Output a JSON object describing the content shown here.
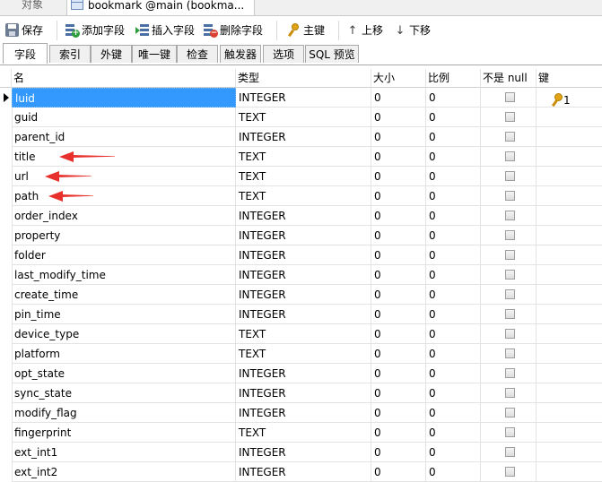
{
  "tabs": {
    "objects": "对象",
    "active": "bookmark @main (bookma..."
  },
  "toolbar": {
    "save": "保存",
    "add_field": "添加字段",
    "insert_field": "插入字段",
    "delete_field": "删除字段",
    "primary_key": "主键",
    "move_up": "上移",
    "move_down": "下移"
  },
  "section_tabs": [
    "字段",
    "索引",
    "外键",
    "唯一键",
    "检查",
    "触发器",
    "选项",
    "SQL 预览"
  ],
  "columns": {
    "name": "名",
    "type": "类型",
    "size": "大小",
    "scale": "比例",
    "not_null": "不是 null",
    "key": "键"
  },
  "rows": [
    {
      "name": "luid",
      "type": "INTEGER",
      "size": "0",
      "scale": "0",
      "key": "1"
    },
    {
      "name": "guid",
      "type": "TEXT",
      "size": "0",
      "scale": "0",
      "key": ""
    },
    {
      "name": "parent_id",
      "type": "INTEGER",
      "size": "0",
      "scale": "0",
      "key": ""
    },
    {
      "name": "title",
      "type": "TEXT",
      "size": "0",
      "scale": "0",
      "key": ""
    },
    {
      "name": "url",
      "type": "TEXT",
      "size": "0",
      "scale": "0",
      "key": ""
    },
    {
      "name": "path",
      "type": "TEXT",
      "size": "0",
      "scale": "0",
      "key": ""
    },
    {
      "name": "order_index",
      "type": "INTEGER",
      "size": "0",
      "scale": "0",
      "key": ""
    },
    {
      "name": "property",
      "type": "INTEGER",
      "size": "0",
      "scale": "0",
      "key": ""
    },
    {
      "name": "folder",
      "type": "INTEGER",
      "size": "0",
      "scale": "0",
      "key": ""
    },
    {
      "name": "last_modify_time",
      "type": "INTEGER",
      "size": "0",
      "scale": "0",
      "key": ""
    },
    {
      "name": "create_time",
      "type": "INTEGER",
      "size": "0",
      "scale": "0",
      "key": ""
    },
    {
      "name": "pin_time",
      "type": "INTEGER",
      "size": "0",
      "scale": "0",
      "key": ""
    },
    {
      "name": "device_type",
      "type": "TEXT",
      "size": "0",
      "scale": "0",
      "key": ""
    },
    {
      "name": "platform",
      "type": "TEXT",
      "size": "0",
      "scale": "0",
      "key": ""
    },
    {
      "name": "opt_state",
      "type": "INTEGER",
      "size": "0",
      "scale": "0",
      "key": ""
    },
    {
      "name": "sync_state",
      "type": "INTEGER",
      "size": "0",
      "scale": "0",
      "key": ""
    },
    {
      "name": "modify_flag",
      "type": "INTEGER",
      "size": "0",
      "scale": "0",
      "key": ""
    },
    {
      "name": "fingerprint",
      "type": "TEXT",
      "size": "0",
      "scale": "0",
      "key": ""
    },
    {
      "name": "ext_int1",
      "type": "INTEGER",
      "size": "0",
      "scale": "0",
      "key": ""
    },
    {
      "name": "ext_int2",
      "type": "INTEGER",
      "size": "0",
      "scale": "0",
      "key": ""
    }
  ],
  "selected_row": 0,
  "highlighted_rows": [
    3,
    4,
    5
  ],
  "colors": {
    "selection": "#3399ff",
    "annotation_arrow": "#e8302c",
    "key_icon": "#e0a414"
  }
}
